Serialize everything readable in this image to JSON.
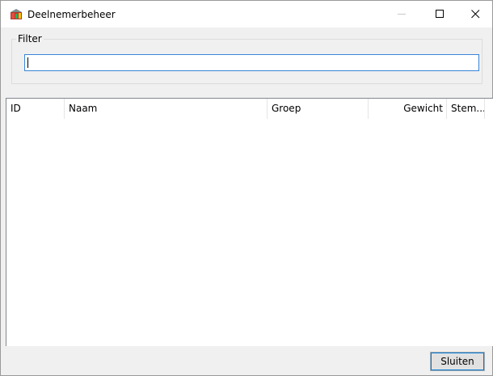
{
  "window": {
    "title": "Deelnemerbeheer",
    "icon": "app-icon",
    "controls": [
      "minimize-icon",
      "maximize-icon",
      "close-icon"
    ]
  },
  "filter": {
    "legend": "Filter",
    "value": "",
    "placeholder": ""
  },
  "list": {
    "columns": [
      "ID",
      "Naam",
      "Groep",
      "Gewicht",
      "Stem..."
    ],
    "rows": []
  },
  "footer": {
    "close_label": "Sluiten"
  },
  "colors": {
    "accent": "#0078d7",
    "input_border": "#3a85d8",
    "window_bg": "#f0f0f0"
  }
}
